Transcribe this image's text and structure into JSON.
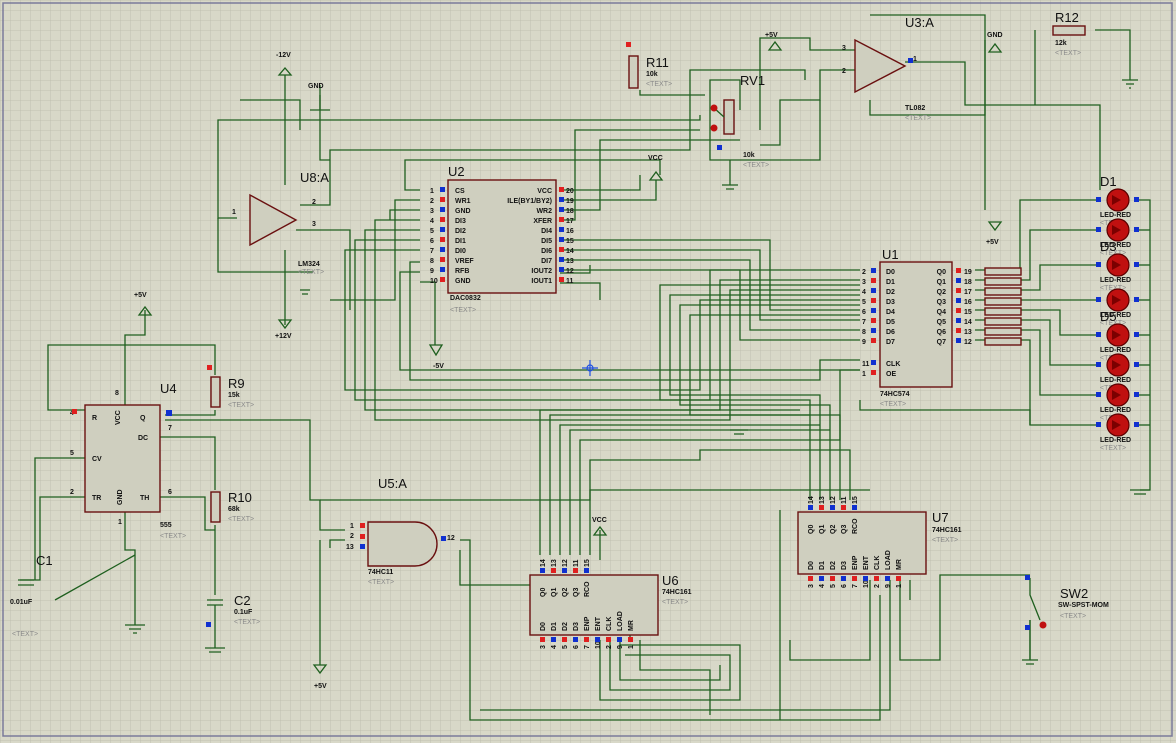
{
  "colors": {
    "background": "#d8d8c8",
    "grid": "#bcbcac",
    "wire": "#1e5f1e",
    "body_outline": "#6a1010",
    "body_fill": "#cfcfbf",
    "led": "#c01010",
    "pin_red": "#e02020",
    "pin_blue": "#1030d0",
    "probe": "#2050e0"
  },
  "placeholder": "<TEXT>",
  "components": {
    "u8": {
      "ref": "U8:A",
      "part": "LM324"
    },
    "u2": {
      "ref": "U2",
      "part": "DAC0832",
      "pins_left": [
        "CS",
        "WR1",
        "GND",
        "DI3",
        "DI2",
        "DI1",
        "DI0",
        "VREF",
        "RFB",
        "GND"
      ],
      "pins_left_num": [
        "1",
        "2",
        "3",
        "4",
        "5",
        "6",
        "7",
        "8",
        "9",
        "10"
      ],
      "pins_right": [
        "VCC",
        "ILE(BY1/BY2)",
        "WR2",
        "XFER",
        "DI4",
        "DI5",
        "DI6",
        "DI7",
        "IOUT2",
        "IOUT1"
      ],
      "pins_right_num": [
        "20",
        "19",
        "18",
        "17",
        "16",
        "15",
        "14",
        "13",
        "12",
        "11"
      ]
    },
    "u1": {
      "ref": "U1",
      "part": "74HC574",
      "pins_left": [
        "D0",
        "D1",
        "D2",
        "D3",
        "D4",
        "D5",
        "D6",
        "D7",
        "CLK",
        "OE"
      ],
      "pins_left_num": [
        "2",
        "3",
        "4",
        "5",
        "6",
        "7",
        "8",
        "9",
        "11",
        "1"
      ],
      "pins_right": [
        "Q0",
        "Q1",
        "Q2",
        "Q3",
        "Q4",
        "Q5",
        "Q6",
        "Q7"
      ],
      "pins_right_num": [
        "19",
        "18",
        "17",
        "16",
        "15",
        "14",
        "13",
        "12"
      ]
    },
    "u3": {
      "ref": "U3:A",
      "part": "TL082",
      "pin_plus": "3",
      "pin_minus": "2",
      "pin_out": "1"
    },
    "u4": {
      "ref": "U4",
      "part": "555",
      "pins": [
        "R",
        "VCC",
        "Q",
        "DC",
        "CV",
        "TR",
        "GND",
        "TH"
      ],
      "pin_nums": [
        "4",
        "8",
        "3",
        "7",
        "5",
        "2",
        "1",
        "6"
      ]
    },
    "u5": {
      "ref": "U5:A",
      "part": "74HC11",
      "pins_in": [
        "1",
        "2",
        "13"
      ],
      "pin_out": "12"
    },
    "u6": {
      "ref": "U6",
      "part": "74HC161",
      "top": [
        "Q0",
        "Q1",
        "Q2",
        "Q3",
        "RCO"
      ],
      "top_num": [
        "14",
        "13",
        "12",
        "11",
        "15"
      ],
      "bottom": [
        "D0",
        "D1",
        "D2",
        "D3",
        "ENP",
        "ENT",
        "CLK",
        "LOAD",
        "MR"
      ],
      "bottom_num": [
        "3",
        "4",
        "5",
        "6",
        "7",
        "10",
        "2",
        "9",
        "1"
      ]
    },
    "u7": {
      "ref": "U7",
      "part": "74HC161",
      "top": [
        "Q0",
        "Q1",
        "Q2",
        "Q3",
        "RCO"
      ],
      "top_num": [
        "14",
        "13",
        "12",
        "11",
        "15"
      ],
      "bottom": [
        "D0",
        "D1",
        "D2",
        "D3",
        "ENP",
        "ENT",
        "CLK",
        "LOAD",
        "MR"
      ],
      "bottom_num": [
        "3",
        "4",
        "5",
        "6",
        "7",
        "10",
        "2",
        "9",
        "1"
      ]
    },
    "r9": {
      "ref": "R9",
      "value": "15k"
    },
    "r10": {
      "ref": "R10",
      "value": "68k"
    },
    "r11": {
      "ref": "R11",
      "value": "10k"
    },
    "r12": {
      "ref": "R12",
      "value": "12k"
    },
    "rv1": {
      "ref": "RV1",
      "value": "10k"
    },
    "c1": {
      "ref": "C1",
      "value": "0.01uF"
    },
    "c2": {
      "ref": "C2",
      "value": "0.1uF"
    },
    "sw2": {
      "ref": "SW2",
      "part": "SW-SPST-MOM"
    },
    "leds": [
      {
        "ref": "D1",
        "part": "LED-RED"
      },
      {
        "ref": "",
        "part": "LED-RED"
      },
      {
        "ref": "D3",
        "part": "LED-RED"
      },
      {
        "ref": "",
        "part": "LED-RED"
      },
      {
        "ref": "D5",
        "part": "LED-RED"
      },
      {
        "ref": "",
        "part": "LED-RED"
      },
      {
        "ref": "",
        "part": "LED-RED"
      },
      {
        "ref": "",
        "part": "LED-RED"
      }
    ]
  },
  "power": {
    "m12": "-12V",
    "gnd": "GND",
    "p12": "+12V",
    "p5": "+5V",
    "vcc": "VCC",
    "m5": "-5V"
  }
}
